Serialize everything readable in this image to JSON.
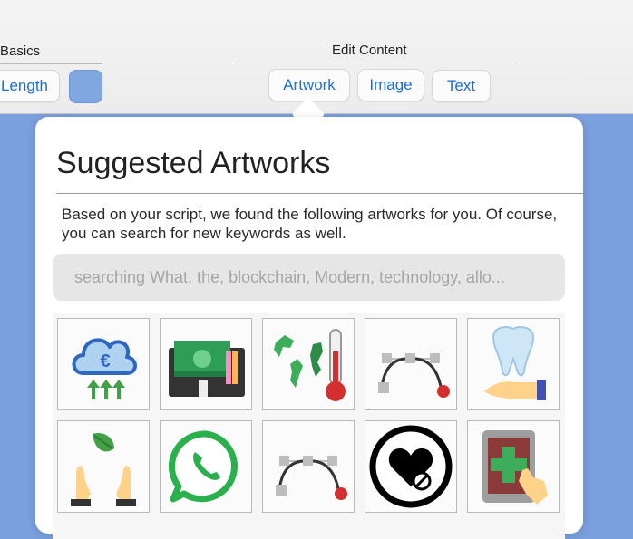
{
  "toolbar": {
    "basics_title": "Basics",
    "length_label": "Length",
    "edit_content_title": "Edit Content",
    "tabs": [
      "Artwork",
      "Image",
      "Text"
    ],
    "swatch_color": "#80a7e0"
  },
  "popover": {
    "title": "Suggested Artworks",
    "description": "Based on your script, we found the following artworks for you. Of course, you can search for new keywords as well.",
    "search_placeholder": "searching What, the, blockchain, Modern, technology, allo..."
  },
  "artworks": [
    {
      "icon": "cloud-euro-upload-icon"
    },
    {
      "icon": "money-wallet-icon"
    },
    {
      "icon": "climate-thermometer-icon"
    },
    {
      "icon": "bezier-curve-icon"
    },
    {
      "icon": "tooth-hand-icon"
    },
    {
      "icon": "hands-leaf-icon"
    },
    {
      "icon": "whatsapp-icon"
    },
    {
      "icon": "bezier-curve-icon"
    },
    {
      "icon": "heart-blocked-icon"
    },
    {
      "icon": "tablet-medical-cross-icon"
    }
  ],
  "colors": {
    "accent": "#1a6fd6",
    "background": "#7aa0de"
  }
}
